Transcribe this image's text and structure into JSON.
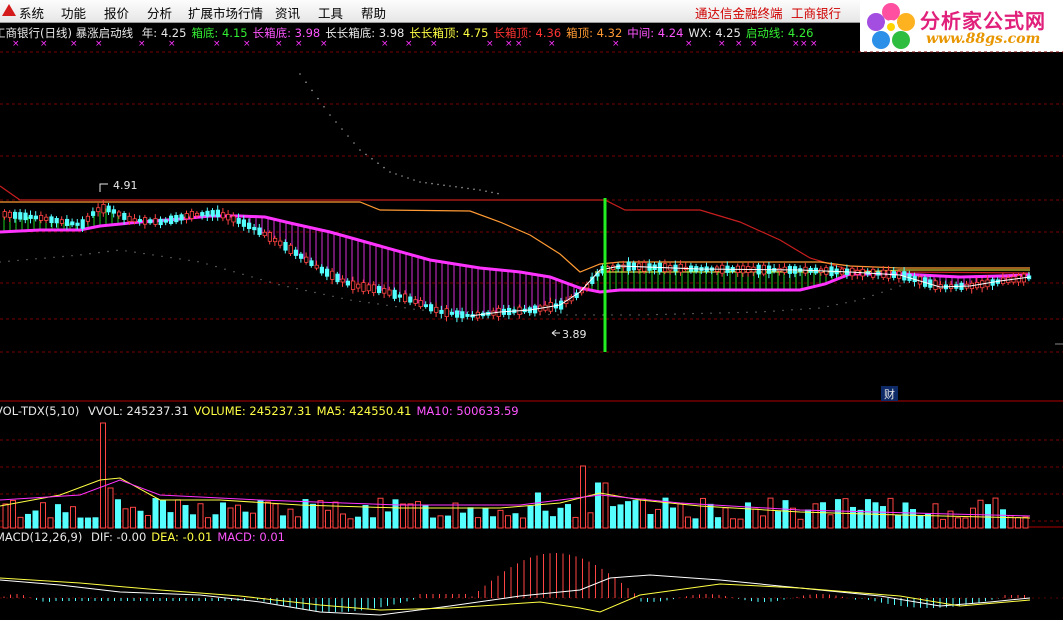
{
  "menu": {
    "items": [
      "系统",
      "功能",
      "报价",
      "分析",
      "扩展市场行情",
      "资讯",
      "工具",
      "帮助"
    ],
    "right_links": [
      "通达信金融终端",
      "工商银行"
    ]
  },
  "brand": {
    "name": "分析家公式网",
    "url": "www.88gs.com"
  },
  "price_panel": {
    "title": "工商银行(日线)",
    "indicator": "暴涨启动线",
    "legend": [
      {
        "label": "年:",
        "value": "4.25",
        "color": "#e8e8e8"
      },
      {
        "label": "箱底:",
        "value": "4.15",
        "color": "#33ee33"
      },
      {
        "label": "长箱底:",
        "value": "3.98",
        "color": "#ff55ff"
      },
      {
        "label": "长长箱底:",
        "value": "3.98",
        "color": "#e8e8e8"
      },
      {
        "label": "长长箱顶:",
        "value": "4.75",
        "color": "#ffff44"
      },
      {
        "label": "长箱顶:",
        "value": "4.36",
        "color": "#ff3333"
      },
      {
        "label": "箱顶:",
        "value": "4.32",
        "color": "#ff9933"
      },
      {
        "label": "中间:",
        "value": "4.24",
        "color": "#ff55ff"
      },
      {
        "label": "WX:",
        "value": "4.25",
        "color": "#e8e8e8"
      },
      {
        "label": "启动线:",
        "value": "4.26",
        "color": "#33ee33"
      }
    ],
    "high_label": "4.91",
    "low_label": "3.89",
    "marker_label": "财"
  },
  "volume_panel": {
    "title": "VOL-TDX(5,10)",
    "legend": [
      {
        "label": "VVOL:",
        "value": "245237.31",
        "color": "#e8e8e8"
      },
      {
        "label": "VOLUME:",
        "value": "245237.31",
        "color": "#ffff44"
      },
      {
        "label": "MA5:",
        "value": "424550.41",
        "color": "#ffff44"
      },
      {
        "label": "MA10:",
        "value": "500633.59",
        "color": "#ff55ff"
      }
    ]
  },
  "macd_panel": {
    "title": "MACD(12,26,9)",
    "legend": [
      {
        "label": "DIF:",
        "value": "-0.00",
        "color": "#e8e8e8"
      },
      {
        "label": "DEA:",
        "value": "-0.01",
        "color": "#ffff44"
      },
      {
        "label": "MACD:",
        "value": "0.01",
        "color": "#ff55ff"
      }
    ]
  },
  "colors": {
    "up": "#ff4444",
    "down": "#55ffff",
    "grid": "#7a0000",
    "ma_magenta": "#ff33ff",
    "ma_white": "#ffffff",
    "orange": "#ff9a33",
    "dark_red": "#c81e1e",
    "green_marker": "#22ee22"
  }
}
